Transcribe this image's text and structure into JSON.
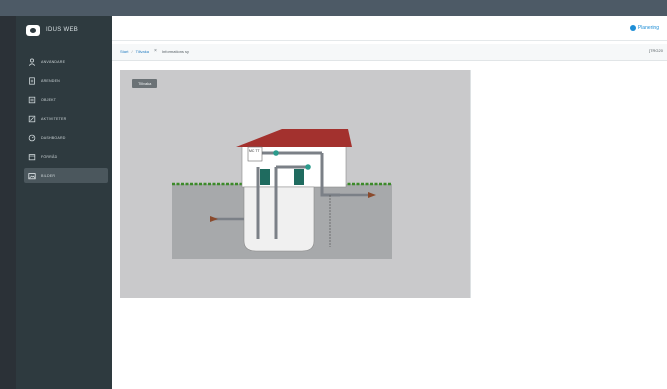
{
  "app": {
    "title": "IDUS WEB"
  },
  "sidebar": {
    "items": [
      {
        "label": "ANVÄNDARE",
        "icon": "user-icon"
      },
      {
        "label": "ÄRENDEN",
        "icon": "document-icon"
      },
      {
        "label": "OBJEKT",
        "icon": "list-icon"
      },
      {
        "label": "AKTIVITETER",
        "icon": "edit-icon"
      },
      {
        "label": "DASHBOARD",
        "icon": "gauge-icon"
      },
      {
        "label": "FÖRRÅD",
        "icon": "inbox-icon"
      },
      {
        "label": "BILDER",
        "icon": "image-icon"
      }
    ],
    "active_index": 6
  },
  "topbar": {
    "planning_label": "Planering"
  },
  "breadcrumb": {
    "start": "Start",
    "item": "Tillvaka",
    "current": "Informations sy",
    "right_text": "[TRG20"
  },
  "viewer": {
    "tag": "Tillvaka"
  },
  "diagram": {
    "box_label": "MC TT"
  },
  "colors": {
    "sidebar_bg": "#2e3a3f",
    "accent": "#1f8ed6",
    "roof": "#a3312e",
    "grass": "#3c8a2a",
    "pump": "#1f6b5f",
    "arrow": "#8a4a2c"
  }
}
